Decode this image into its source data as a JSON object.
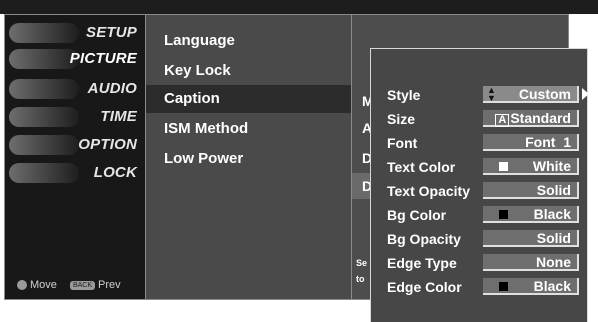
{
  "sidebar": {
    "categories": [
      {
        "label": "SETUP"
      },
      {
        "label": "PICTURE"
      },
      {
        "label": "AUDIO"
      },
      {
        "label": "TIME"
      },
      {
        "label": "OPTION"
      },
      {
        "label": "LOCK"
      }
    ],
    "hint_move": "Move",
    "hint_back_key": "BACK",
    "hint_prev": "Prev"
  },
  "menu": {
    "items": [
      {
        "label": "Language"
      },
      {
        "label": "Key Lock"
      },
      {
        "label": "Caption"
      },
      {
        "label": "ISM Method"
      },
      {
        "label": "Low Power"
      }
    ]
  },
  "backpanel": {
    "letters": [
      "M",
      "A",
      "D",
      "D"
    ],
    "note_line1": "Se",
    "note_line2": "to"
  },
  "popup": {
    "rows": [
      {
        "label": "Style",
        "value": "Custom"
      },
      {
        "label": "Size",
        "value": "Standard",
        "value_prefix": "A"
      },
      {
        "label": "Font",
        "value": "Font  1"
      },
      {
        "label": "Text Color",
        "value": "White",
        "swatch": "#ffffff"
      },
      {
        "label": "Text Opacity",
        "value": "Solid"
      },
      {
        "label": "Bg Color",
        "value": "Black",
        "swatch": "#000000"
      },
      {
        "label": "Bg Opacity",
        "value": "Solid"
      },
      {
        "label": "Edge Type",
        "value": "None"
      },
      {
        "label": "Edge Color",
        "value": "Black",
        "swatch": "#000000"
      }
    ]
  },
  "colors": {
    "sidebar_bg": "#181818",
    "menu_bg": "#4a4a4a",
    "popup_bg": "#474747",
    "value_bg": "#6e6e6e"
  }
}
